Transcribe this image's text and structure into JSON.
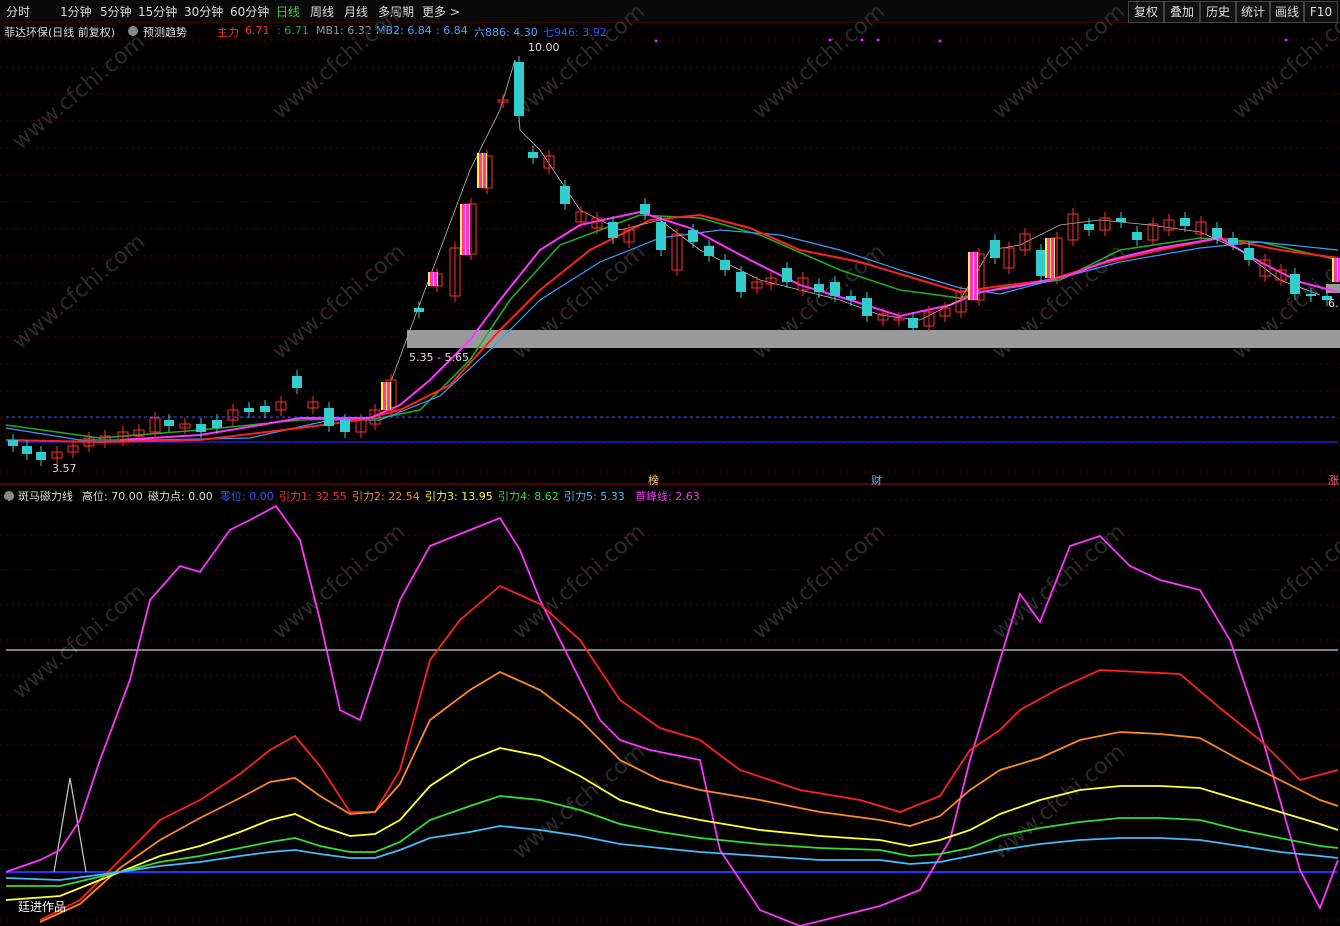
{
  "toolbar": {
    "periods": [
      "分时",
      "1分钟",
      "5分钟",
      "15分钟",
      "30分钟",
      "60分钟",
      "日线",
      "周线",
      "月线",
      "多周期",
      "更多 >"
    ],
    "active_period": "日线",
    "right_buttons": [
      "复权",
      "叠加",
      "历史",
      "统计",
      "画线",
      "F10"
    ]
  },
  "main_header": {
    "stock_name": "菲达环保(日线 前复权)",
    "trend_label": "预测趋势",
    "zhuli_label": "主力",
    "zhuli_value": "6.71",
    "v2": ": 6.71",
    "mb1": "MB1: 6.32",
    "mb2": "MB2: 6.84",
    "v3": ": 6.84",
    "liu": "六886: 4.30",
    "qi": "七946: 3.92"
  },
  "main_chart": {
    "high_label": "10.00",
    "low_label": "3.57",
    "zone_label": "5.35 - 5.65",
    "right_price": "6.",
    "marker_bang": "榜",
    "marker_cai": "财",
    "marker_zhang": "涨"
  },
  "sub_header": {
    "name": "斑马磁力线",
    "gaowei": "高位: 70.00",
    "cilidian": "磁力点: 0.00",
    "lingwei": "零位: 0.00",
    "yinli1": "引力1: 32.55",
    "yinli2": "引力2: 22.54",
    "yinli3": "引力3: 13.95",
    "yinli4": "引力4: 8.62",
    "yinli5": "引力5: 5.33",
    "shoufeng": "首峰线: 2.63"
  },
  "sub_chart": {
    "author_label": "廷进作品"
  },
  "watermark": "www.cfchi.com",
  "colors": {
    "up": "#ff3030",
    "down": "#33cccc",
    "magenta": "#ff33ff",
    "red_line": "#ff2020",
    "green_line": "#22aa22",
    "blue_line": "#4488ff"
  }
}
